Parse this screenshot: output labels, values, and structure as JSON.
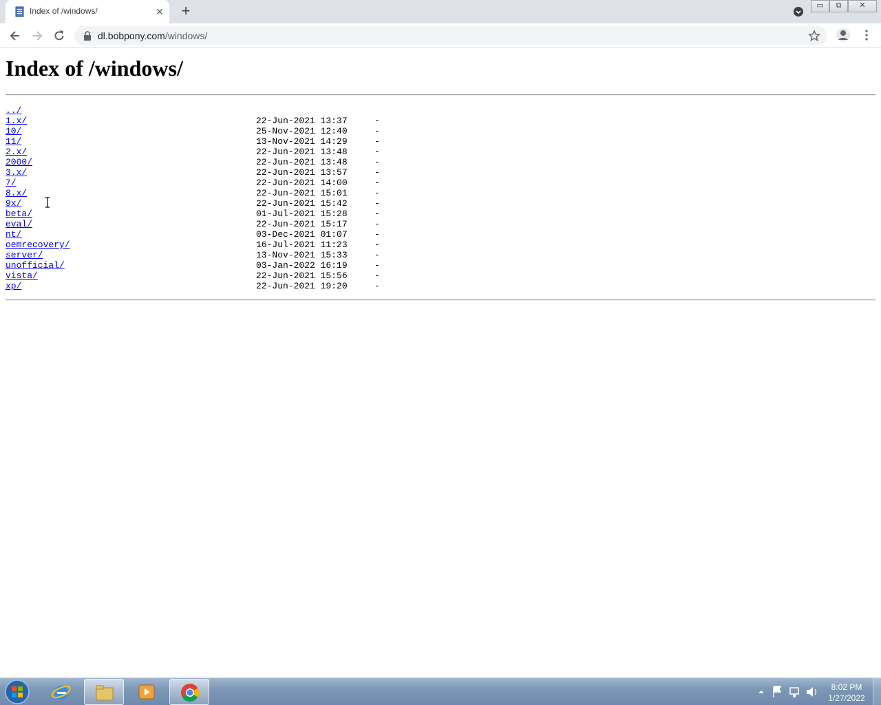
{
  "browser": {
    "tab": {
      "title": "Index of /windows/",
      "close": "✕"
    },
    "new_tab": "+",
    "window_buttons": {
      "minimize": "▭",
      "maximize": "⧉",
      "close": "✕"
    },
    "url": {
      "host": "dl.bobpony.com",
      "path": "/windows/"
    }
  },
  "page": {
    "heading": "Index of /windows/",
    "entries": [
      {
        "name": "../",
        "date": "",
        "size": ""
      },
      {
        "name": "1.x/",
        "date": "22-Jun-2021 13:37",
        "size": "-"
      },
      {
        "name": "10/",
        "date": "25-Nov-2021 12:40",
        "size": "-"
      },
      {
        "name": "11/",
        "date": "13-Nov-2021 14:29",
        "size": "-"
      },
      {
        "name": "2.x/",
        "date": "22-Jun-2021 13:48",
        "size": "-"
      },
      {
        "name": "2000/",
        "date": "22-Jun-2021 13:48",
        "size": "-"
      },
      {
        "name": "3.x/",
        "date": "22-Jun-2021 13:57",
        "size": "-"
      },
      {
        "name": "7/",
        "date": "22-Jun-2021 14:00",
        "size": "-"
      },
      {
        "name": "8.x/",
        "date": "22-Jun-2021 15:01",
        "size": "-"
      },
      {
        "name": "9x/",
        "date": "22-Jun-2021 15:42",
        "size": "-"
      },
      {
        "name": "beta/",
        "date": "01-Jul-2021 15:28",
        "size": "-"
      },
      {
        "name": "eval/",
        "date": "22-Jun-2021 15:17",
        "size": "-"
      },
      {
        "name": "nt/",
        "date": "03-Dec-2021 01:07",
        "size": "-"
      },
      {
        "name": "oemrecovery/",
        "date": "16-Jul-2021 11:23",
        "size": "-"
      },
      {
        "name": "server/",
        "date": "13-Nov-2021 15:33",
        "size": "-"
      },
      {
        "name": "unofficial/",
        "date": "03-Jan-2022 16:19",
        "size": "-"
      },
      {
        "name": "vista/",
        "date": "22-Jun-2021 15:56",
        "size": "-"
      },
      {
        "name": "xp/",
        "date": "22-Jun-2021 19:20",
        "size": "-"
      }
    ]
  },
  "taskbar": {
    "pinned": [
      "start-orb-icon",
      "internet-explorer-icon",
      "file-explorer-icon",
      "media-player-icon",
      "chrome-icon"
    ],
    "clock": {
      "time": "8:02 PM",
      "date": "1/27/2022"
    }
  },
  "colors": {
    "link": "#0000ee",
    "tabstrip": "#dee1e6",
    "omnibox": "#f1f3f4"
  }
}
